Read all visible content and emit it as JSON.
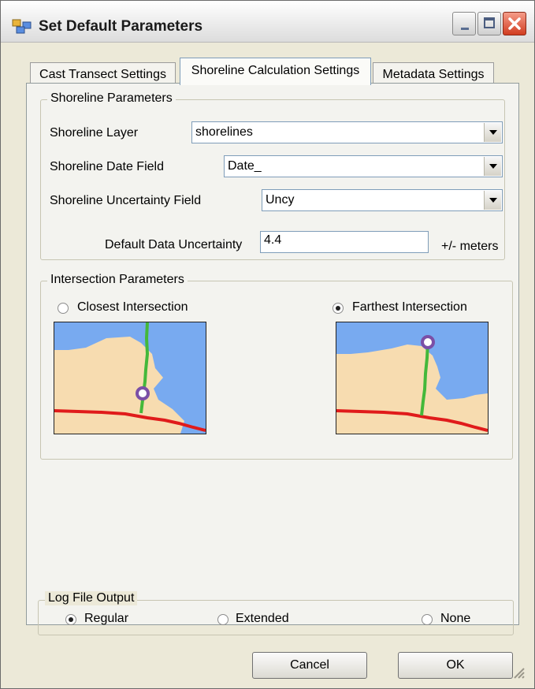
{
  "window": {
    "title": "Set Default Parameters"
  },
  "tabs": [
    {
      "label": "Cast Transect Settings"
    },
    {
      "label": "Shoreline Calculation Settings"
    },
    {
      "label": "Metadata Settings"
    }
  ],
  "shoreline_params": {
    "title": "Shoreline Parameters",
    "layer_label": "Shoreline Layer",
    "layer_value": "shorelines",
    "date_label": "Shoreline Date Field",
    "date_value": "Date_",
    "uncertainty_label": "Shoreline Uncertainty Field",
    "uncertainty_value": "Uncy",
    "default_uncertainty_label": "Default Data Uncertainty",
    "default_uncertainty_value": "4.4",
    "units": "+/- meters"
  },
  "intersection_params": {
    "title": "Intersection Parameters",
    "closest_label": "Closest Intersection",
    "farthest_label": "Farthest Intersection",
    "selected": "farthest"
  },
  "log_output": {
    "title": "Log File Output",
    "regular_label": "Regular",
    "extended_label": "Extended",
    "none_label": "None",
    "selected": "regular"
  },
  "buttons": {
    "cancel": "Cancel",
    "ok": "OK"
  },
  "colors": {
    "sand": "#f7dcb0",
    "water": "#78aaf0",
    "transect": "#44b83a",
    "baseline": "#e01b1b",
    "intersection": "#7b4fa6"
  }
}
